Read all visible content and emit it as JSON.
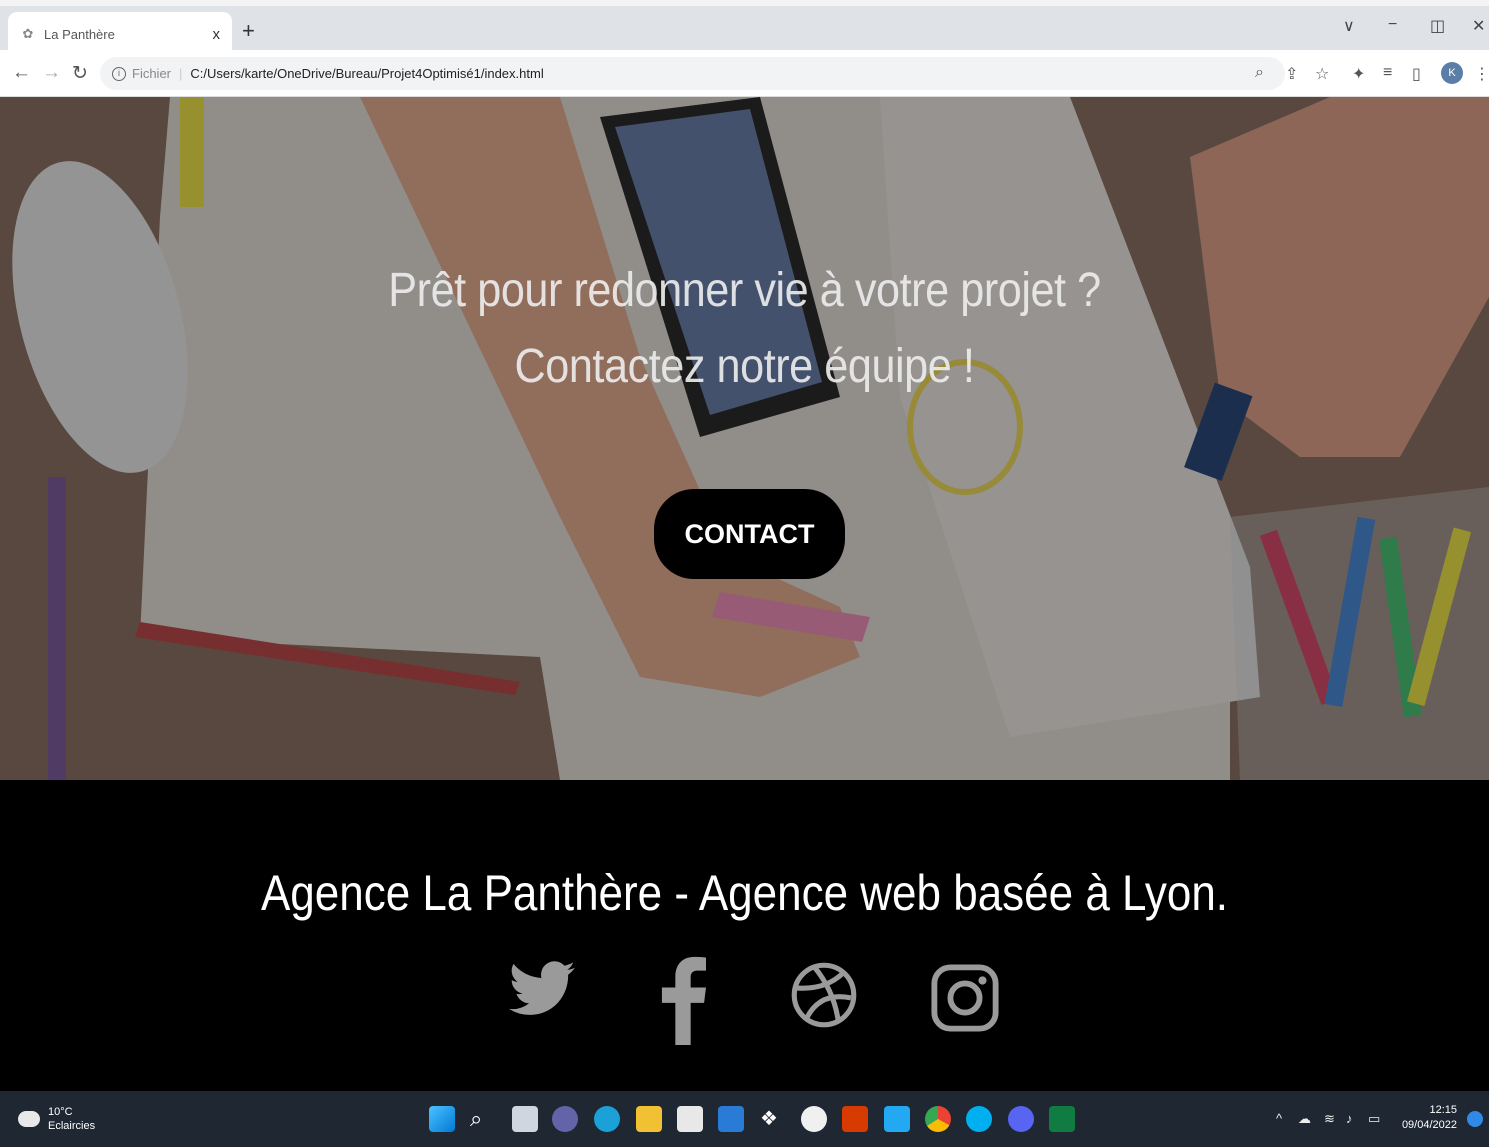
{
  "browser": {
    "tab_title": "La Panthère",
    "tab_close": "x",
    "new_tab": "+",
    "scheme_label": "Fichier",
    "url": "C:/Users/karte/OneDrive/Bureau/Projet4Optimisé1/index.html",
    "profile_initial": "K",
    "window_controls": [
      "chevron-down-icon",
      "minimize-icon",
      "restore-icon",
      "close-icon"
    ],
    "toolbar_icons": [
      "zoom-icon",
      "share-icon",
      "star-icon",
      "extensions-icon",
      "reading-list-icon",
      "side-panel-icon",
      "menu-icon"
    ]
  },
  "hero": {
    "line1": "Prêt pour redonner vie à votre projet ?",
    "line2": "Contactez notre équipe !",
    "cta_label": "CONTACT"
  },
  "footer": {
    "tagline": "Agence La Panthère - Agence web basée à Lyon.",
    "social_icons": [
      "twitter-icon",
      "facebook-icon",
      "dribbble-icon",
      "instagram-icon"
    ],
    "icon_color": "#9a9a9a"
  },
  "taskbar": {
    "temperature": "10°C",
    "weather": "Eclaircies",
    "time": "12:15",
    "date": "09/04/2022",
    "apps": [
      "windows-start",
      "search",
      "task-view",
      "teams",
      "edge",
      "file-explorer",
      "store",
      "mail",
      "dropbox",
      "github",
      "office",
      "vscode",
      "chrome",
      "skype",
      "discord",
      "excel"
    ]
  }
}
